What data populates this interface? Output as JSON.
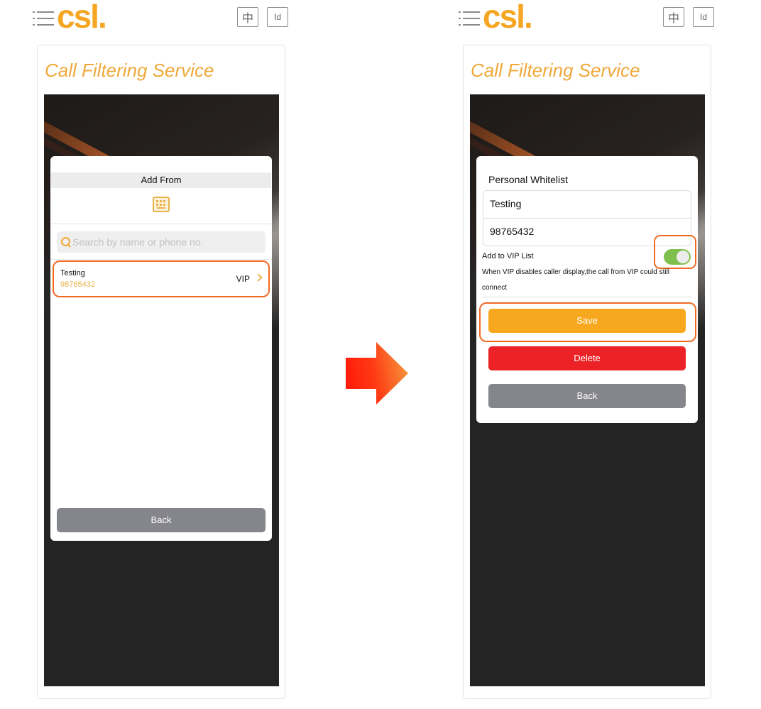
{
  "brand": {
    "logo_text": "csl.",
    "accent_color": "#f5a623",
    "highlight_color": "#f06a25"
  },
  "header": {
    "menu_icon": "hamburger-menu-icon",
    "lang_chinese": "中",
    "lang_indonesian": "Id"
  },
  "page_title": "Call Filtering Service",
  "left_screen": {
    "modal_title": "Add From",
    "keypad_icon": "keypad-icon",
    "search": {
      "placeholder": "Search by name or phone no.",
      "value": ""
    },
    "contacts": [
      {
        "name": "Testing",
        "number": "98765432",
        "tag": "VIP"
      }
    ],
    "back_label": "Back"
  },
  "arrow_icon": "right-arrow-icon",
  "right_screen": {
    "section_title": "Personal Whitelist",
    "name_value": "Testing",
    "number_value": "98765432",
    "vip_label": "Add to VIP List",
    "vip_enabled": true,
    "vip_note": "When VIP disables caller display,the call from VIP could still connect",
    "save_label": "Save",
    "delete_label": "Delete",
    "back_label": "Back",
    "colors": {
      "save": "#f7a81f",
      "delete": "#ec2226",
      "back": "#85858c",
      "toggle_on": "#7fbf4d"
    }
  }
}
